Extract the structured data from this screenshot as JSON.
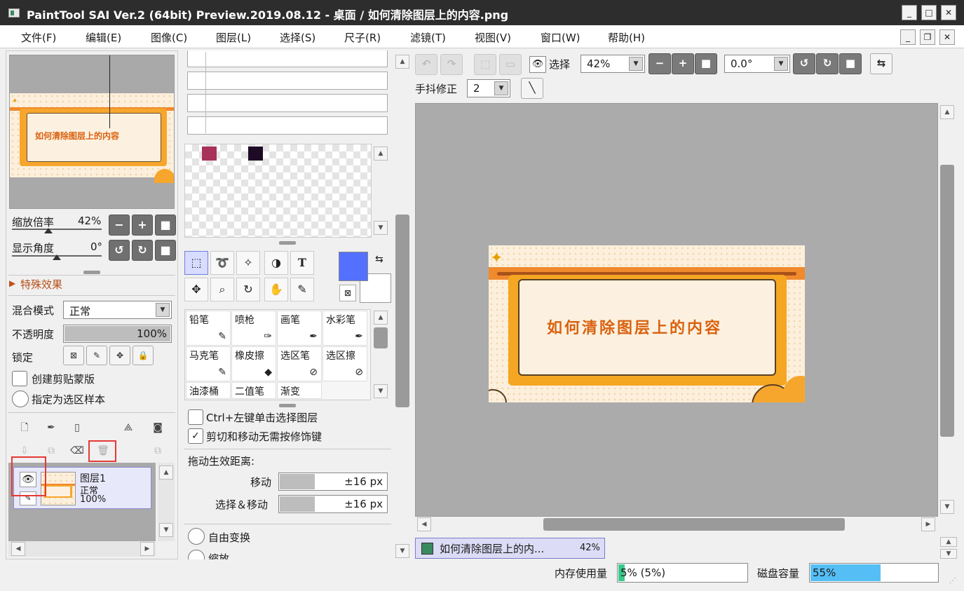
{
  "window": {
    "title": "PaintTool SAI Ver.2 (64bit) Preview.2019.08.12 - 桌面 / 如何清除图层上的内容.png",
    "controls": {
      "minimize": "_",
      "maximize": "□",
      "close": "✕"
    }
  },
  "menu": {
    "items": [
      "文件(F)",
      "编辑(E)",
      "图像(C)",
      "图层(L)",
      "选择(S)",
      "尺子(R)",
      "滤镜(T)",
      "视图(V)",
      "窗口(W)",
      "帮助(H)"
    ],
    "controls": {
      "minimize": "_",
      "restore": "❐",
      "close": "✕"
    }
  },
  "navigator": {
    "zoom_label": "缩放倍率",
    "zoom_value": "42%",
    "angle_label": "显示角度",
    "angle_value": "0°",
    "zoom_level": 0.42
  },
  "layer_props": {
    "section_title": "特殊效果",
    "blend_label": "混合模式",
    "blend_value": "正常",
    "opacity_label": "不透明度",
    "opacity_value": "100%",
    "opacity_level": 1.0,
    "lock_label": "锁定",
    "clip_label": "创建剪贴蒙版",
    "sample_label": "指定为选区样本"
  },
  "layers": [
    {
      "name": "图层1",
      "mode": "正常",
      "opacity": "100%"
    }
  ],
  "colors": {
    "swatch1": "#a8315a",
    "swatch2": "#1e0a24",
    "primary": "#5470ff",
    "secondary": "#ffffff",
    "accent_red": "#e53935",
    "card_orange": "#f5a623",
    "title_orange": "#d9620f"
  },
  "tools": {
    "row1": [
      "⬚",
      "✂",
      "✧",
      "◑",
      "T"
    ],
    "row2": [
      "✥",
      "⌕",
      "↻",
      "✋",
      "✎"
    ]
  },
  "brushes": [
    "铅笔",
    "喷枪",
    "画笔",
    "水彩笔",
    "马克笔",
    "橡皮擦",
    "选区笔",
    "选区擦",
    "油漆桶",
    "二值笔",
    "渐变"
  ],
  "options": {
    "ctrl_click_label": "Ctrl+左键单击选择图层",
    "cut_move_label": "剪切和移动无需按修饰键",
    "cut_move_checked": "✓",
    "drag_distance_label": "拖动生效距离:",
    "move_label": "移动",
    "move_value": "±16 px",
    "select_move_label": "选择＆移动",
    "select_move_value": "±16 px",
    "free_transform_label": "自由变换",
    "scale_label": "缩放"
  },
  "toolbar": {
    "select_label": "选择",
    "zoom_value": "42%",
    "angle_value": "0.0°",
    "stabilizer_label": "手抖修正",
    "stabilizer_value": "2"
  },
  "canvas": {
    "banner_text": "如何清除图层上的内容"
  },
  "doc_tab": {
    "name": "如何清除图层上的内...",
    "zoom": "42%"
  },
  "status": {
    "memory_label": "内存使用量",
    "memory_value": "5% (5%)",
    "memory_level": 0.05,
    "disk_label": "磁盘容量",
    "disk_value": "55%",
    "disk_level": 0.55
  }
}
